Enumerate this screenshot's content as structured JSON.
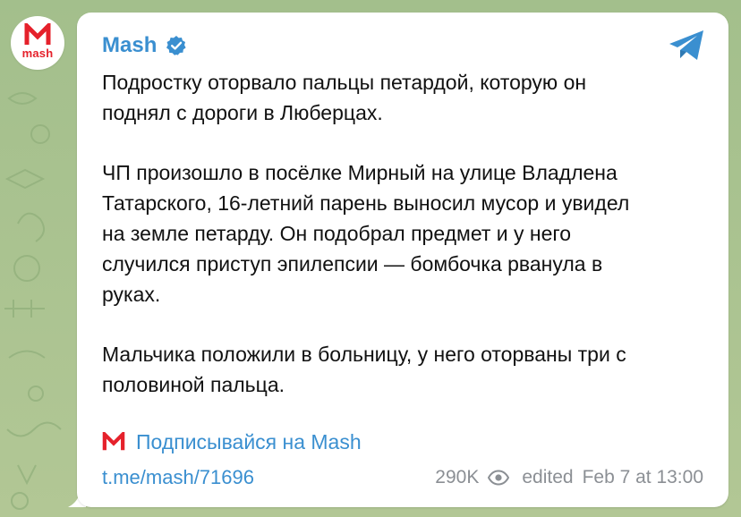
{
  "colors": {
    "background": "#a9c08f",
    "bubble": "#ffffff",
    "link": "#3a8fd0",
    "brand": "#e5212b",
    "meta": "#8b8f94"
  },
  "channel": {
    "name": "Mash",
    "avatar_text": "mash",
    "verified_icon": "verified-badge-icon",
    "share_icon": "telegram-share-icon"
  },
  "post": {
    "paragraphs": [
      [
        "Подростку оторвало пальцы петардой, которую он",
        "поднял с дороги в Люберцах."
      ],
      [
        "ЧП произошло в посёлке Мирный на улице Владлена",
        "Татарского, 16-летний парень выносил мусор и увидел",
        "на земле петарду. Он подобрал предмет и у него",
        "случился приступ эпилепсии — бомбочка рванула в",
        "руках."
      ],
      [
        "Мальчика положили в больницу, у него оторваны три с",
        "половиной пальца."
      ]
    ],
    "subscribe_text": "Подписывайся на Mash",
    "link": "t.me/mash/71696",
    "views": "290K",
    "views_icon": "eye-icon",
    "edited_label": "edited",
    "timestamp": "Feb 7 at 13:00"
  }
}
